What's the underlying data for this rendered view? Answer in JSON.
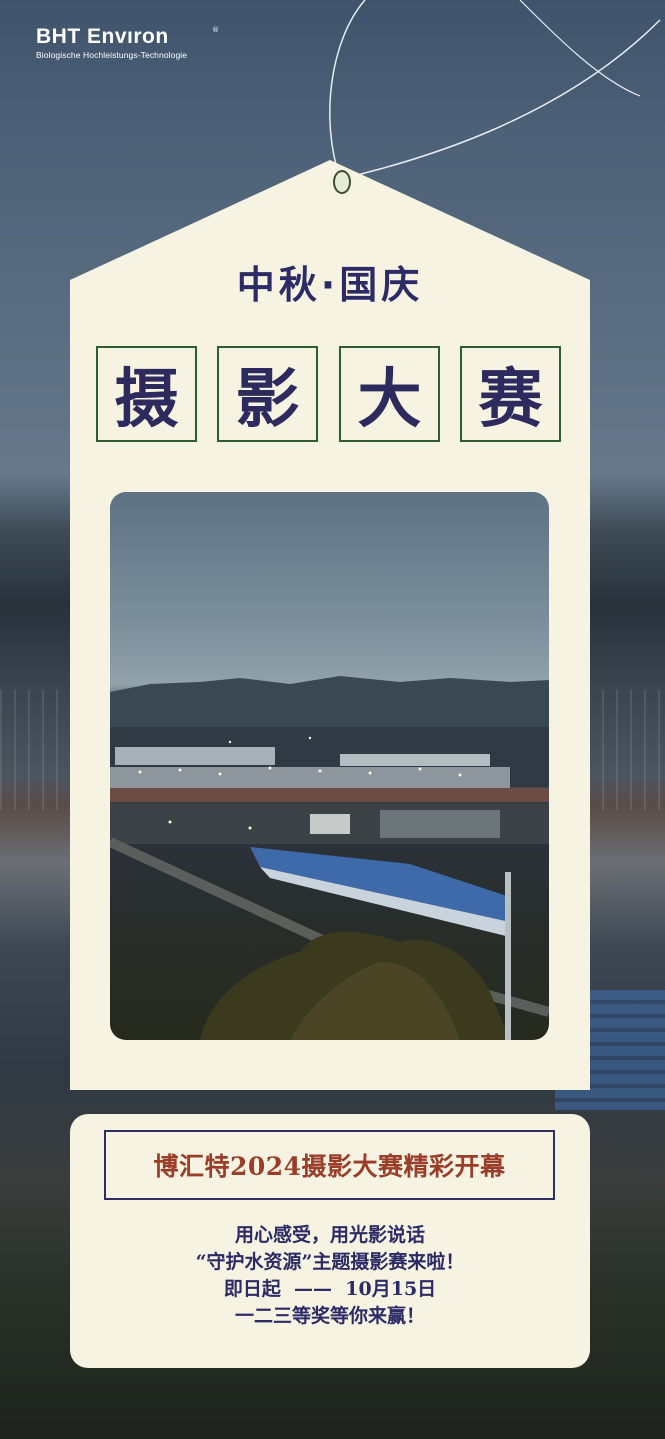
{
  "logo": {
    "name": "BHT Envıron",
    "registered": "®",
    "tagline": "Biologische Hochleistungs-Technologie"
  },
  "event": {
    "subtitle": "中秋·国庆",
    "title_chars": [
      "摄",
      "影",
      "大",
      "赛"
    ]
  },
  "announcement": {
    "banner": "博汇特2024摄影大赛精彩开幕",
    "lines": [
      "用心感受，用光影说话",
      "“守护水资源”主题摄影赛来啦！",
      "即日起  ——  10月15日",
      "一二三等奖等你来赢！"
    ]
  },
  "colors": {
    "card": "#f6f3e3",
    "title_navy": "#2c2b66",
    "box_border": "#2f5e2f",
    "banner_red": "#9a3e2a"
  },
  "icons": [
    "tag-hanging-hole-icon",
    "hanging-string-icon"
  ]
}
